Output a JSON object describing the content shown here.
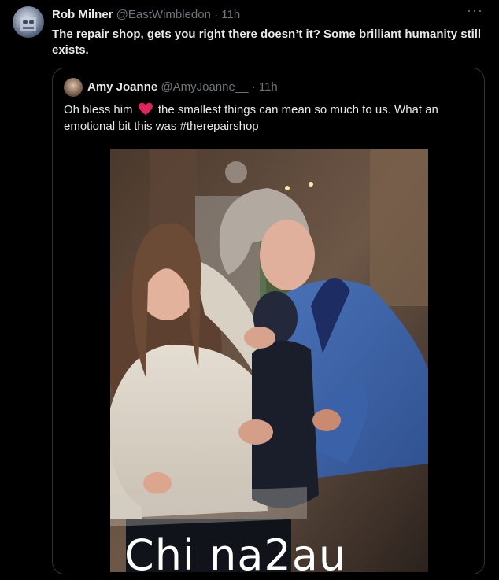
{
  "tweet": {
    "author_name": "Rob Milner",
    "author_handle": "@EastWimbledon",
    "separator": "·",
    "time": "11h",
    "more_icon": "more-icon",
    "text": "The repair shop, gets you right there doesn’t it? Some brilliant humanity still exists."
  },
  "quoted_tweet": {
    "author_name": "Amy Joanne",
    "author_handle": "@AmyJoanne__",
    "separator": "·",
    "time": "11h",
    "text_before_heart": "Oh bless him",
    "heart_icon": "red-heart-icon",
    "text_after_heart": "the smallest things can mean so much to us. What an emotional bit this was #therepairshop"
  },
  "watermark": "Chi na2au",
  "colors": {
    "background": "#000000",
    "primary_text": "#e7e9ea",
    "secondary_text": "#71767b",
    "border": "#2f3336",
    "heart": "#e0245e"
  }
}
